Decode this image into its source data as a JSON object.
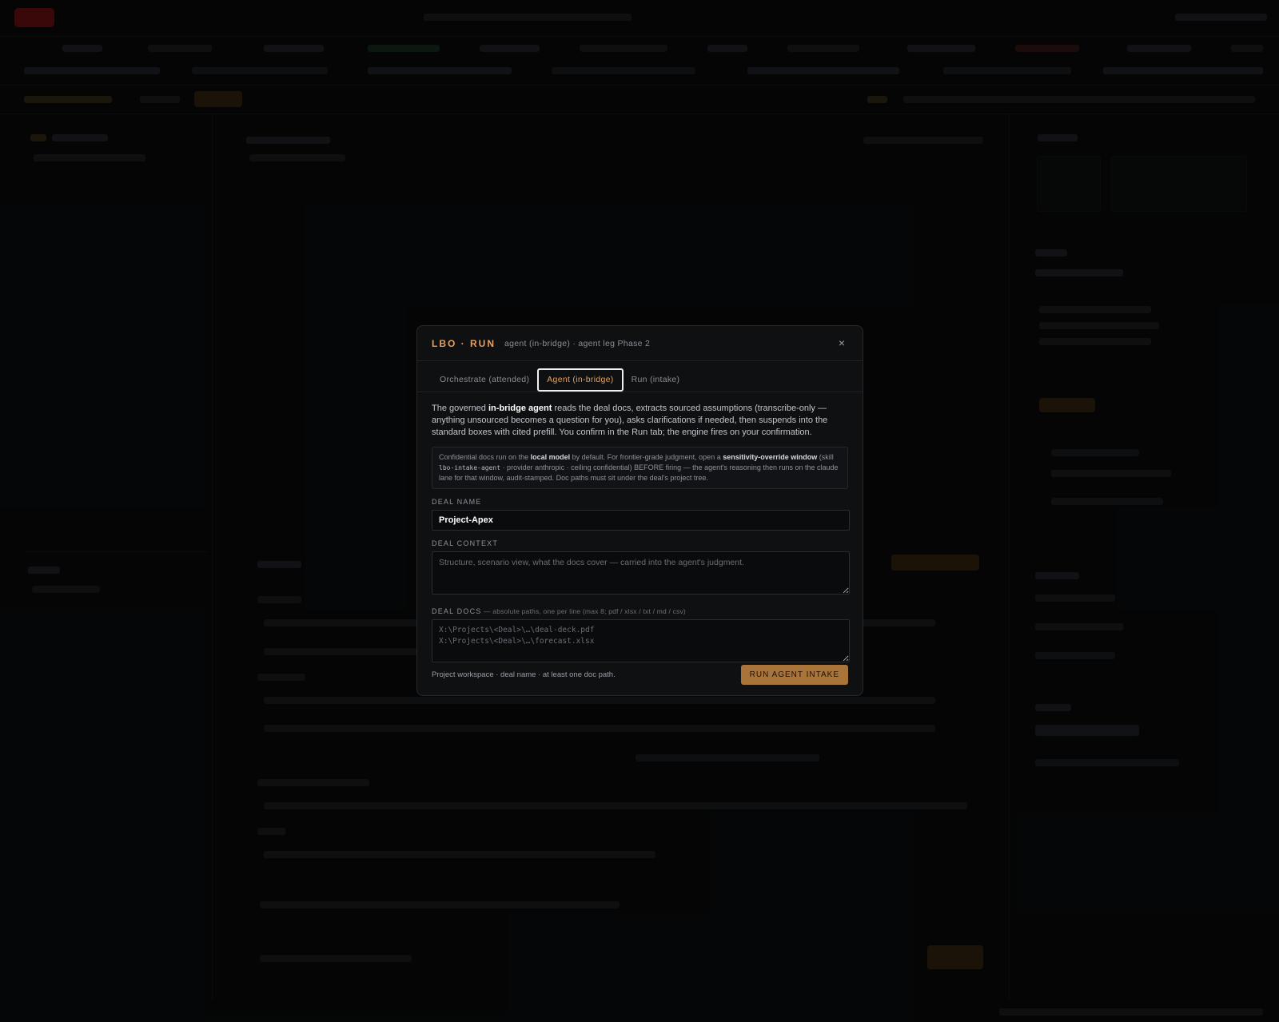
{
  "modal": {
    "title": "LBO · RUN",
    "subtitle": "agent (in-bridge) · agent leg Phase 2",
    "close_icon": "×",
    "tabs": [
      {
        "label": "Orchestrate (attended)",
        "active": false
      },
      {
        "label": "Agent (in-bridge)",
        "active": true
      },
      {
        "label": "Run (intake)",
        "active": false
      }
    ],
    "intro": {
      "p1": "The governed ",
      "bold1": "in-bridge agent",
      "p2": " reads the deal docs, extracts sourced assumptions (transcribe-only — anything unsourced becomes a question for you), asks clarifications if needed, then suspends into the standard boxes with cited prefill. You confirm in the Run tab; the engine fires on your confirmation."
    },
    "note": {
      "t1": "Confidential docs run on the ",
      "b1": "local model",
      "t2": " by default. For frontier-grade judgment, open a ",
      "b2": "sensitivity-override window",
      "t3": " (skill ",
      "code": "lbo-intake-agent",
      "t4": " · provider anthropic · ceiling confidential) BEFORE firing — the agent's reasoning then runs on the claude lane for that window, audit-stamped. Doc paths must sit under the deal's project tree."
    },
    "deal_name": {
      "label": "DEAL NAME",
      "value": "Project-Apex"
    },
    "deal_context": {
      "label": "DEAL CONTEXT",
      "placeholder": "Structure, scenario view, what the docs cover — carried into the agent's judgment."
    },
    "deal_docs": {
      "label": "DEAL DOCS",
      "hint": " — absolute paths, one per line (max 8; pdf / xlsx / txt / md / csv)",
      "placeholder": "X:\\Projects\\<Deal>\\…\\deal-deck.pdf\nX:\\Projects\\<Deal>\\…\\forecast.xlsx"
    },
    "footer_note": "Project workspace · deal name · at least one doc path.",
    "run_button": "RUN AGENT INTAKE"
  },
  "colors": {
    "accent": "#e8a05a",
    "button": "#a8743a",
    "background": "#08090a"
  }
}
